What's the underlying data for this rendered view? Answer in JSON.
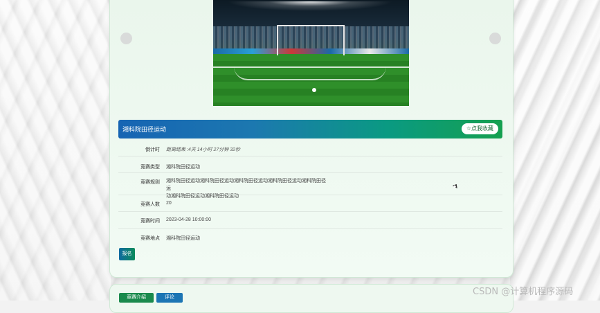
{
  "header": {
    "title": "湘科院田径运动",
    "favorite_label": "☆点我收藏"
  },
  "details": {
    "countdown_label": "倒计时",
    "countdown_value": "距离结束 :4天 14小时 27分钟 32秒",
    "type_label": "竞赛类型",
    "type_value": "湘科院田径运动",
    "rules_label": "竞赛规则",
    "rules_line1": "湘科院田径运动湘科院田径运动湘科院田径运动湘科院田径运动湘科院田径运",
    "rules_line2": "动湘科院田径运动湘科院田径运动",
    "count_label": "竞赛人数",
    "count_value": "20",
    "time_label": "竞赛时间",
    "time_value": "2023-04-28 10:00:00",
    "location_label": "竞赛地点",
    "location_value": "湘科院田径运动"
  },
  "buttons": {
    "signup": "报名",
    "tab_intro": "竞赛介绍",
    "tab_comments": "评论"
  },
  "watermark": "CSDN @计算机程序源码",
  "colors": {
    "header_gradient_start": "#1664b3",
    "header_gradient_end": "#15a050",
    "card_bg": "#eaf6ec"
  }
}
